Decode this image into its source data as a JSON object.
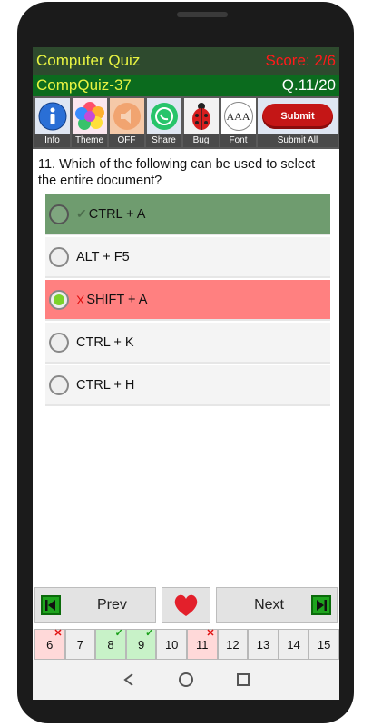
{
  "header": {
    "app_title": "Computer Quiz",
    "score": "Score: 2/6",
    "quiz_id": "CompQuiz-37",
    "question_counter": "Q.11/20"
  },
  "toolbar": {
    "items": [
      {
        "label": "Info",
        "icon": "info-icon"
      },
      {
        "label": "Theme",
        "icon": "theme-flower-icon"
      },
      {
        "label": "OFF",
        "icon": "speaker-icon"
      },
      {
        "label": "Share",
        "icon": "share-icon"
      },
      {
        "label": "Bug",
        "icon": "ladybug-icon"
      },
      {
        "label": "Font",
        "icon": "font-size-icon",
        "glyph": "AAA"
      },
      {
        "label": "Submit All",
        "icon": "submit-button",
        "button_text": "Submit"
      }
    ]
  },
  "question": {
    "text": "11. Which of the following can be used to select the entire document?"
  },
  "options": [
    {
      "text": "CTRL + A",
      "state": "correct",
      "mark": "✔"
    },
    {
      "text": "ALT + F5",
      "state": "none",
      "mark": ""
    },
    {
      "text": "SHIFT + A",
      "state": "wrong-selected",
      "mark": "X"
    },
    {
      "text": "CTRL + K",
      "state": "none",
      "mark": ""
    },
    {
      "text": "CTRL + H",
      "state": "none",
      "mark": ""
    }
  ],
  "nav": {
    "prev_label": "Prev",
    "next_label": "Next"
  },
  "pager": [
    {
      "num": "6",
      "state": "wrong"
    },
    {
      "num": "7",
      "state": "none"
    },
    {
      "num": "8",
      "state": "right"
    },
    {
      "num": "9",
      "state": "right"
    },
    {
      "num": "10",
      "state": "none"
    },
    {
      "num": "11",
      "state": "wrong"
    },
    {
      "num": "12",
      "state": "none"
    },
    {
      "num": "13",
      "state": "none"
    },
    {
      "num": "14",
      "state": "none"
    },
    {
      "num": "15",
      "state": "none"
    }
  ],
  "colors": {
    "title_bar": "#2e4a2e",
    "sub_bar": "#0b6b1e",
    "correct": "#6f9c6f",
    "wrong": "#ff8080",
    "accent_yellow": "#e8f442",
    "score_red": "#ff1a1a"
  }
}
